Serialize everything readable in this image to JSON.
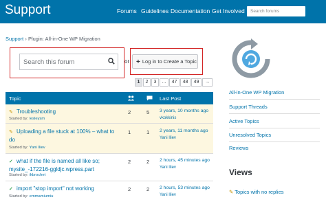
{
  "header": {
    "logo": "Support",
    "nav": [
      "Forums",
      "Guidelines",
      "Documentation",
      "Get Involved"
    ],
    "search_placeholder": "Search forums"
  },
  "breadcrumb": {
    "home": "Support",
    "separator": " › ",
    "current": "Plugin: All-in-One WP Migration"
  },
  "forum_search": {
    "placeholder": "Search this forum",
    "or": "or",
    "login_label": "Log in to Create a Topic"
  },
  "pagination": [
    "1",
    "2",
    "3",
    "...",
    "47",
    "48",
    "49",
    "→"
  ],
  "table": {
    "columns": [
      "Topic",
      "Last Post"
    ],
    "rows": [
      {
        "icon": "pin",
        "title": [
          "Troubleshooting"
        ],
        "started_prefix": "Started by: ",
        "author": "lesleysm",
        "voices": "2",
        "posts": "5",
        "last_post": "3 years, 10 months ago",
        "last_user": "vkokkinis"
      },
      {
        "icon": "pin",
        "title": [
          "Uploading a file stuck at 100% – what to",
          "do"
        ],
        "started_prefix": "Started by: ",
        "author": "Yani Iliev",
        "voices": "1",
        "posts": "1",
        "last_post": "2 years, 11 months ago",
        "last_user": "Yani Iliev"
      },
      {
        "icon": "check",
        "title": [
          "what if the file is named all like so;",
          "mysite_-172216-ggldjc.wpress.part"
        ],
        "started_prefix": "Started by: ",
        "author": "ikbrochet",
        "voices": "2",
        "posts": "2",
        "last_post": "2 hours, 45 minutes ago",
        "last_user": "Yani Iliev"
      },
      {
        "icon": "check",
        "title": [
          "import \"stop import\" not working"
        ],
        "started_prefix": "Started by: ",
        "author": "emmamiumiu",
        "voices": "2",
        "posts": "2",
        "last_post": "2 hours, 53 minutes ago",
        "last_user": "Yani Iliev"
      }
    ]
  },
  "sidebar": {
    "plugin_name": "All-in-One WP Migration",
    "links": [
      "Support Threads",
      "Active Topics",
      "Unresolved Topics",
      "Reviews"
    ],
    "views_heading": "Views",
    "views_items": [
      "Topics with no replies"
    ]
  },
  "colors": {
    "header": "#0073aa",
    "sticky_row": "#fdf7e0",
    "highlight": "#d32626"
  }
}
